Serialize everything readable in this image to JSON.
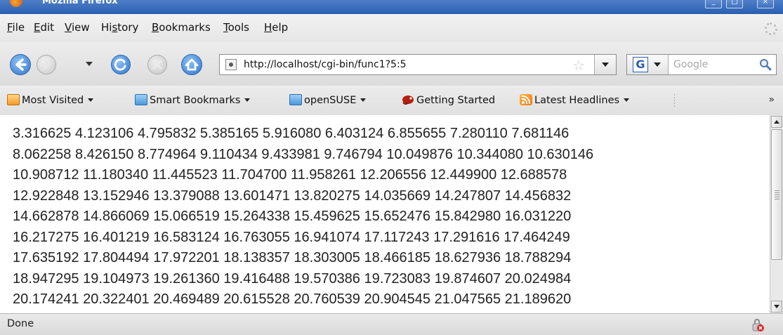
{
  "window": {
    "title": "Mozilla Firefox"
  },
  "menu": {
    "items": [
      {
        "label": "File",
        "underline": "F",
        "rest": "ile"
      },
      {
        "label": "Edit",
        "underline": "E",
        "rest": "dit"
      },
      {
        "label": "View",
        "underline": "V",
        "rest": "iew"
      },
      {
        "label": "History",
        "pre": "Hi",
        "underline": "s",
        "rest": "tory"
      },
      {
        "label": "Bookmarks",
        "underline": "B",
        "rest": "ookmarks"
      },
      {
        "label": "Tools",
        "underline": "T",
        "rest": "ools"
      },
      {
        "label": "Help",
        "underline": "H",
        "rest": "elp"
      }
    ]
  },
  "navbar": {
    "url": "http://localhost/cgi-bin/func1?5:5",
    "search_engine": "G",
    "search_placeholder": "Google"
  },
  "bookmarks": {
    "items": [
      {
        "label": "Most Visited",
        "icon": "most-visited-folder-icon",
        "dropdown": true
      },
      {
        "label": "Smart Bookmarks",
        "icon": "folder-icon",
        "dropdown": true
      },
      {
        "label": "openSUSE",
        "icon": "folder-icon",
        "dropdown": true
      },
      {
        "label": "Getting Started",
        "icon": "opensuse-chameleon-icon",
        "dropdown": false
      },
      {
        "label": "Latest Headlines",
        "icon": "rss-icon",
        "dropdown": true
      }
    ],
    "overflow": "»"
  },
  "content": {
    "lines": [
      "3.316625 4.123106 4.795832 5.385165 5.916080 6.403124 6.855655 7.280110 7.681146",
      "8.062258 8.426150 8.774964 9.110434 9.433981 9.746794 10.049876 10.344080 10.630146",
      "10.908712 11.180340 11.445523 11.704700 11.958261 12.206556 12.449900 12.688578",
      "12.922848 13.152946 13.379088 13.601471 13.820275 14.035669 14.247807 14.456832",
      "14.662878 14.866069 15.066519 15.264338 15.459625 15.652476 15.842980 16.031220",
      "16.217275 16.401219 16.583124 16.763055 16.941074 17.117243 17.291616 17.464249",
      "17.635192 17.804494 17.972201 18.138357 18.303005 18.466185 18.627936 18.788294",
      "18.947295 19.104973 19.261360 19.416488 19.570386 19.723083 19.874607 20.024984",
      "20.174241 20.322401 20.469489 20.615528 20.760539 20.904545 21.047565 21.189620"
    ]
  },
  "status": {
    "text": "Done"
  },
  "colors": {
    "titlebar": "#2a5fb0",
    "chrome": "#e4e4e4",
    "content_bg": "#ffffff",
    "text": "#222222"
  }
}
